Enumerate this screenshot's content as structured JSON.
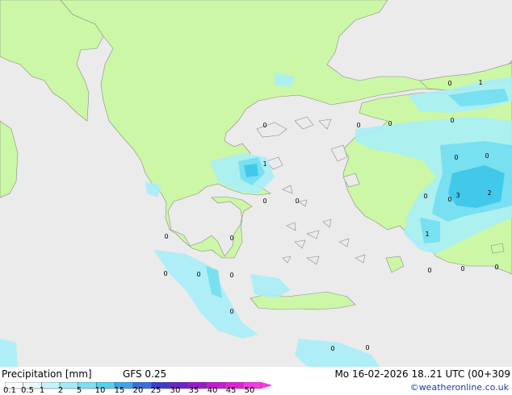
{
  "map": {
    "region": "Greece / Aegean Sea",
    "colors": {
      "sea": "#ebebeb",
      "land": "#ccf7a6",
      "border": "#9a9a9a",
      "precip_light": "#a8eef7",
      "precip_mid": "#72def0",
      "precip_high": "#3fc6ea"
    },
    "point_values": [
      "1",
      "0",
      "0",
      "0",
      "0",
      "0",
      "0",
      "1",
      "0",
      "0",
      "3",
      "2",
      "0",
      "0",
      "0",
      "1",
      "0",
      "0",
      "0",
      "0",
      "0",
      "0",
      "0",
      "0",
      "0",
      "0",
      "0"
    ]
  },
  "footer": {
    "title": "Precipitation [mm]",
    "model": "GFS 0.25",
    "datetime": "Mo 16-02-2026 18..21 UTC (00+309",
    "credit": "©weatheronline.co.uk",
    "scale_labels": [
      "0.1",
      "0.5",
      "1",
      "2",
      "5",
      "10",
      "15",
      "20",
      "25",
      "30",
      "35",
      "40",
      "45",
      "50"
    ],
    "scale_colors": [
      "#ffffff",
      "#e6fafb",
      "#c4f3f8",
      "#a0ebf6",
      "#7ddff2",
      "#55cfee",
      "#3fa3e6",
      "#3b6fd8",
      "#3a3fc8",
      "#6a25c4",
      "#9a1ac6",
      "#c41ad0",
      "#e022d6",
      "#f03ce0"
    ]
  }
}
